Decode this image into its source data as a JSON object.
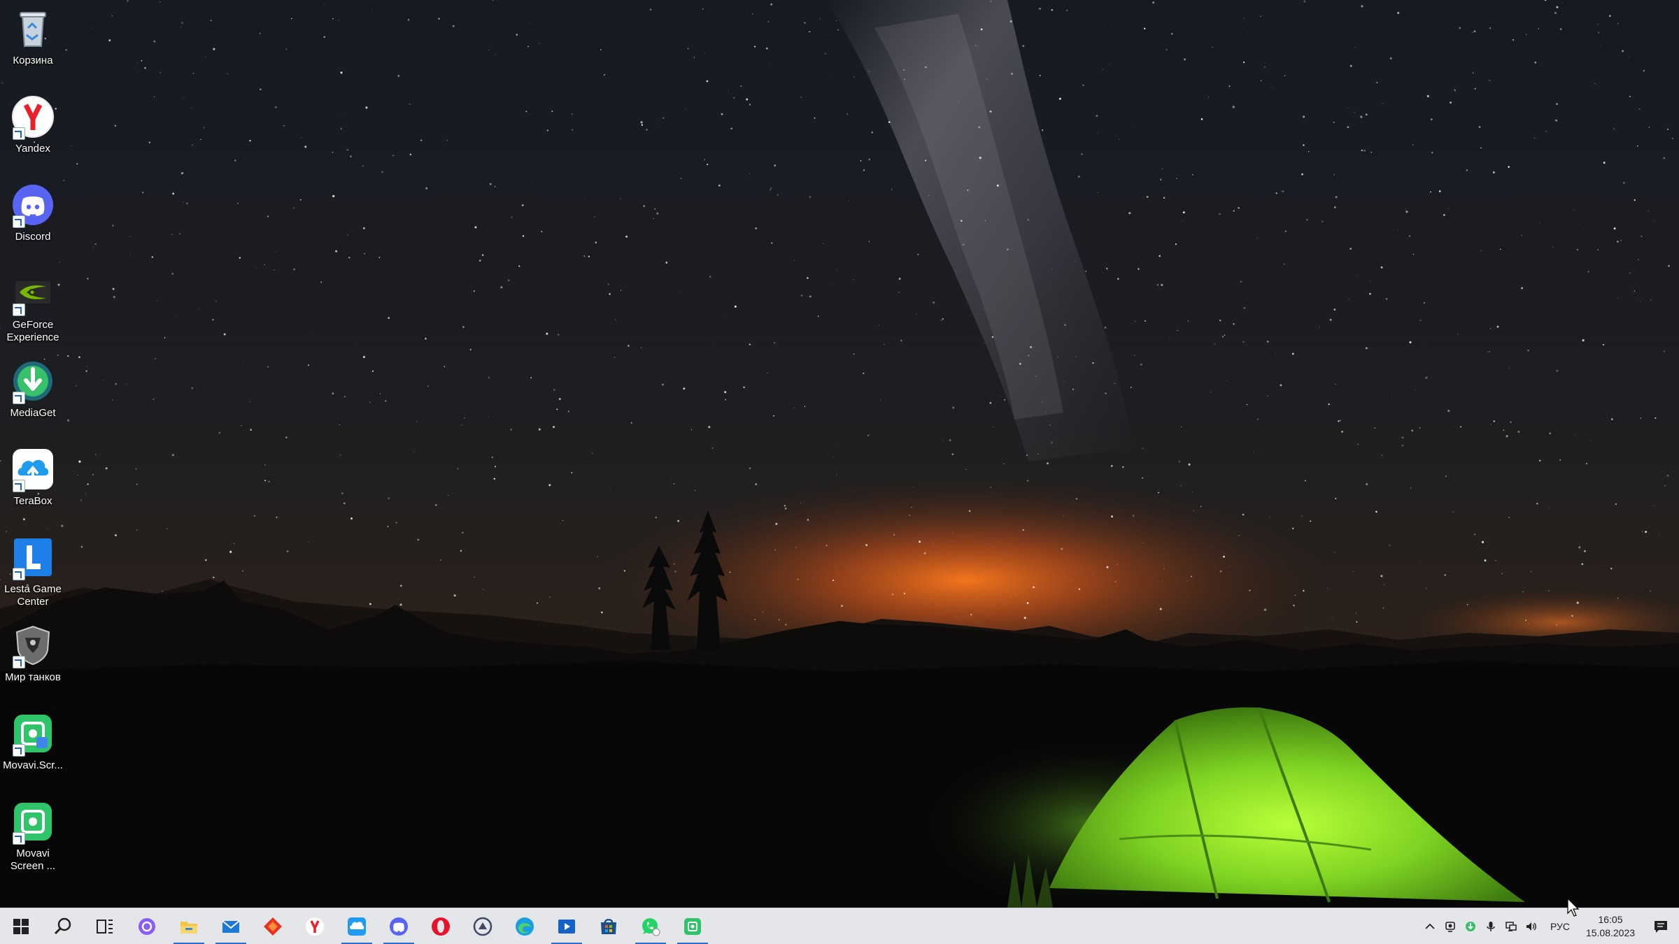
{
  "desktop": {
    "icons": [
      {
        "label": "Корзина",
        "icon": "recycle-bin-icon"
      },
      {
        "label": "Yandex",
        "icon": "yandex-browser-icon"
      },
      {
        "label": "Discord",
        "icon": "discord-icon"
      },
      {
        "label": "GeForce Experience",
        "icon": "geforce-experience-icon"
      },
      {
        "label": "MediaGet",
        "icon": "mediaget-icon"
      },
      {
        "label": "TeraBox",
        "icon": "terabox-icon"
      },
      {
        "label": "Lesta Game Center",
        "icon": "lesta-game-center-icon"
      },
      {
        "label": "Мир танков",
        "icon": "mir-tankov-icon"
      },
      {
        "label": "Movavi.Scr...",
        "icon": "movavi-screen-recorder-icon"
      },
      {
        "label": "Movavi Screen ...",
        "icon": "movavi-screen-icon"
      }
    ]
  },
  "taskbar": {
    "pinned": [
      "start-icon",
      "search-icon",
      "task-view-icon",
      "alice-icon",
      "file-explorer-icon",
      "mail-icon",
      "red-app-icon",
      "yandex-browser-icon",
      "terabox-icon",
      "discord-icon",
      "opera-icon",
      "lesta-icon",
      "edge-icon",
      "video-player-icon",
      "store-icon",
      "whatsapp-icon",
      "movavi-icon"
    ],
    "tray": {
      "language": "РУС",
      "time": "16:05",
      "date": "15.08.2023"
    }
  },
  "colors": {
    "taskbar_bg": "#e4e6ea",
    "accent": "#2a6fd6",
    "tent": "#8ee830"
  }
}
